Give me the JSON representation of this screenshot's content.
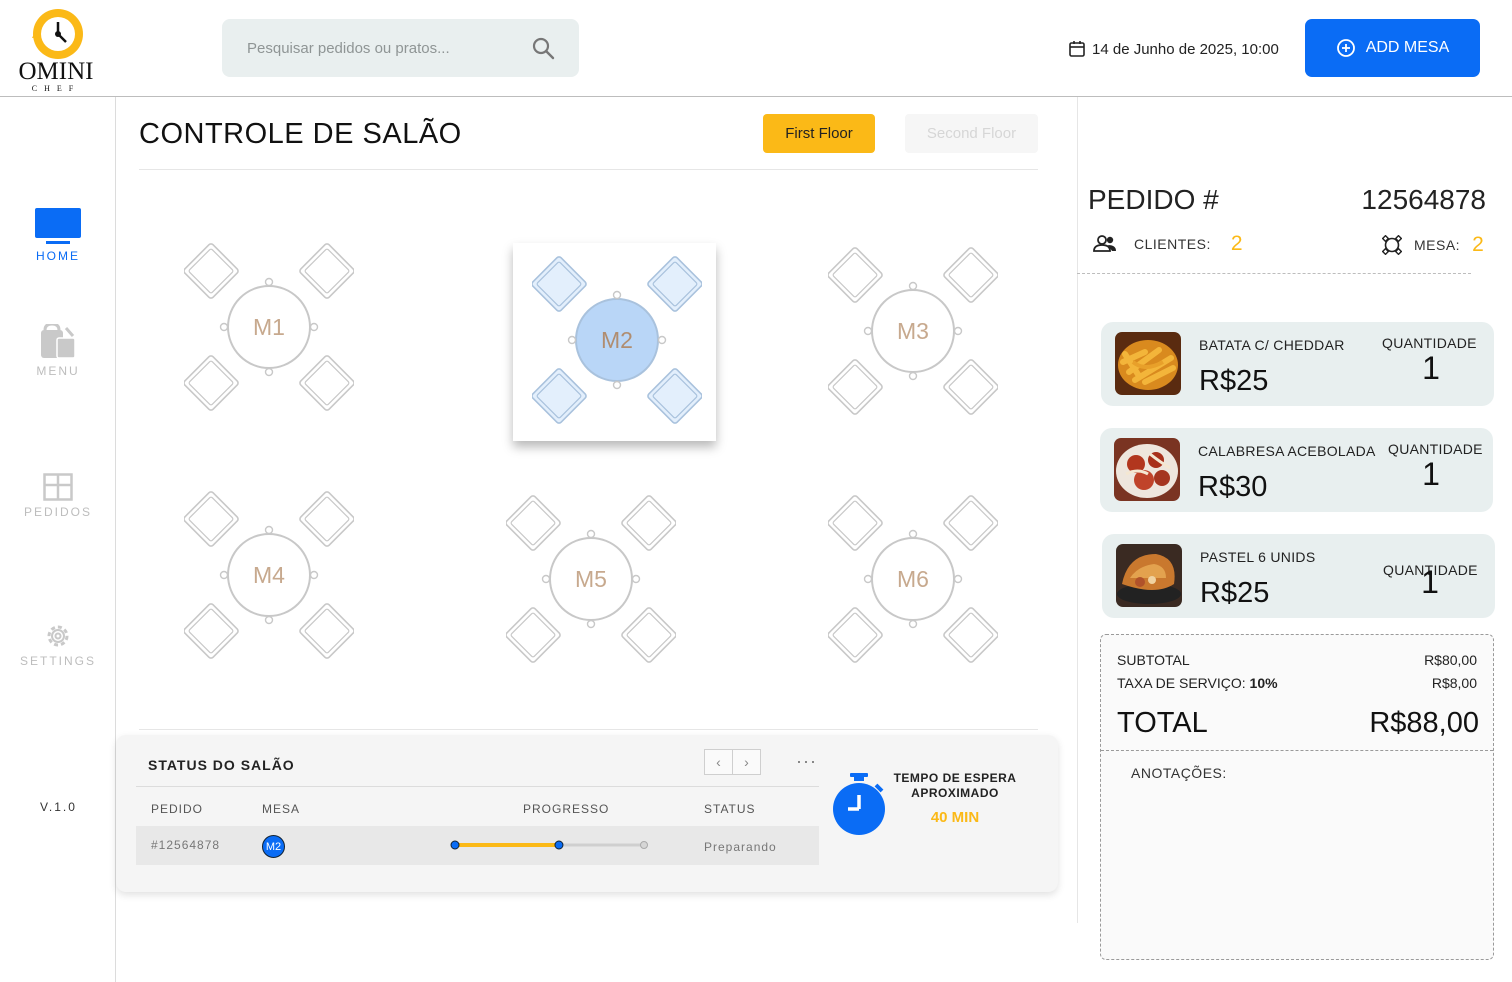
{
  "logo": {
    "text": "OMINI",
    "subtext": "CHEF"
  },
  "search": {
    "placeholder": "Pesquisar pedidos ou pratos..."
  },
  "header": {
    "datetime": "14 de Junho de 2025, 10:00",
    "add_button": "ADD MESA"
  },
  "sidebar": {
    "items": [
      {
        "label": "HOME",
        "icon": "monitor-icon",
        "active": true
      },
      {
        "label": "MENU",
        "icon": "menu-bag-icon",
        "active": false
      },
      {
        "label": "PEDIDOS",
        "icon": "grid-icon",
        "active": false
      },
      {
        "label": "SETTINGS",
        "icon": "gear-icon",
        "active": false
      }
    ],
    "version": "V.1.0"
  },
  "main": {
    "title": "CONTROLE DE SALÃO",
    "floors": [
      "First Floor",
      "Second Floor"
    ],
    "active_floor": "First Floor",
    "tables": [
      {
        "label": "M1",
        "selected": false
      },
      {
        "label": "M2",
        "selected": true
      },
      {
        "label": "M3",
        "selected": false
      },
      {
        "label": "M4",
        "selected": false
      },
      {
        "label": "M5",
        "selected": false
      },
      {
        "label": "M6",
        "selected": false
      }
    ]
  },
  "status": {
    "title": "STATUS DO SALÃO",
    "columns": [
      "PEDIDO",
      "MESA",
      "PROGRESSO",
      "STATUS"
    ],
    "rows": [
      {
        "pedido": "#12564878",
        "mesa": "M2",
        "progress": 0.55,
        "status": "Preparando"
      }
    ],
    "wait_label": "TEMPO DE ESPERA APROXIMADO",
    "wait_time": "40 MIN"
  },
  "order": {
    "label": "PEDIDO #",
    "number": "12564878",
    "clients_label": "CLIENTES:",
    "clients": "2",
    "table_label": "MESA:",
    "table": "2",
    "quantity_label": "QUANTIDADE",
    "items": [
      {
        "name": "BATATA C/ CHEDDAR",
        "price": "R$25",
        "quantity": "1"
      },
      {
        "name": "CALABRESA ACEBOLADA",
        "price": "R$30",
        "quantity": "1"
      },
      {
        "name": "PASTEL 6 UNIDS",
        "price": "R$25",
        "quantity": "1"
      }
    ],
    "subtotal_label": "SUBTOTAL",
    "subtotal": "R$80,00",
    "service_label": "TAXA DE SERVIÇO:",
    "service_pct": "10%",
    "service": "R$8,00",
    "total_label": "TOTAL",
    "total": "R$88,00",
    "notes_label": "ANOTAÇÕES:"
  },
  "colors": {
    "accent": "#0a6cf5",
    "yellow": "#fbb917",
    "table_stroke": "#c8c8c8",
    "selected_table": "#b9d6f7"
  }
}
